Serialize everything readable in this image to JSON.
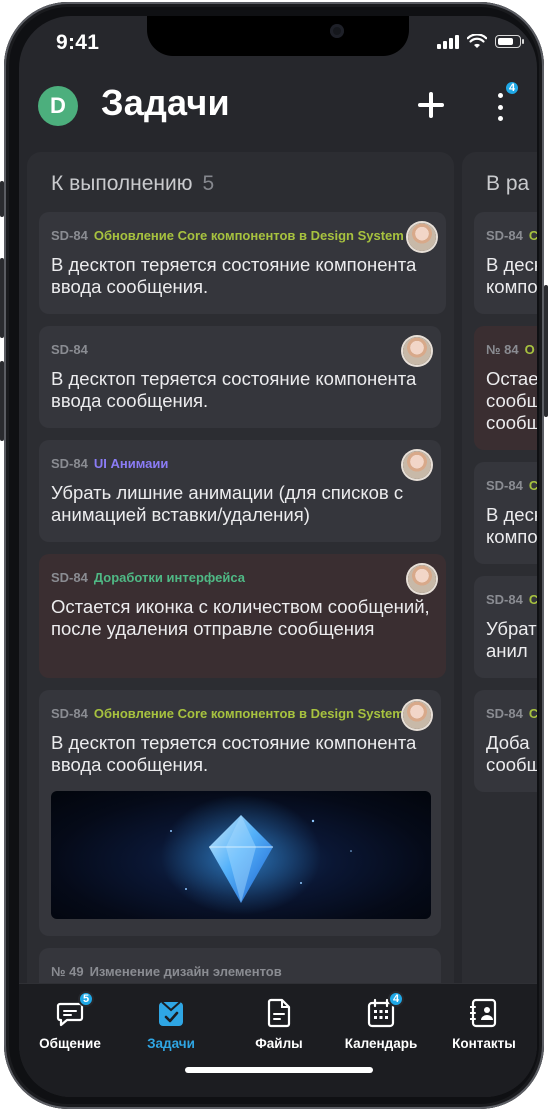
{
  "status_bar": {
    "time": "9:41",
    "battery_fraction": 0.85
  },
  "header": {
    "avatar_letter": "D",
    "title": "Задачи",
    "more_badge": "4"
  },
  "columns": [
    {
      "title": "К выполнению",
      "count": "5",
      "cards": [
        {
          "id": "SD-84",
          "tag": "Обновление Core компонентов в Design System",
          "tag_color": "#a7c23f",
          "text": "В десктоп теряется состояние компонента ввода сообщения."
        },
        {
          "id": "SD-84",
          "tag": "",
          "tag_color": "",
          "text": "В десктоп теряется состояние компонента ввода сообщения."
        },
        {
          "id": "SD-84",
          "tag": "UI Анимаии",
          "tag_color": "#8b7cf6",
          "text": "Убрать лишние анимации (для списков с анимацией вставки/удаления)"
        },
        {
          "id": "SD-84",
          "tag": "Доработки интерфейса",
          "tag_color": "#4fb985",
          "text": "Остается иконка с количеством сообщений, после удаления отправле сообщения"
        },
        {
          "id": "SD-84",
          "tag": "Обновление Core компонентов в Design System",
          "tag_color": "#a7c23f",
          "text": "В десктоп теряется состояние компонента ввода сообщения."
        },
        {
          "id": "№ 49",
          "tag": "Изменение дизайн элементов",
          "tag_color": "#8a8c92",
          "text": ""
        }
      ]
    },
    {
      "title": "В ра",
      "count": "",
      "cards": [
        {
          "id": "SD-84",
          "tag": "",
          "tag_color": "#a7c23f",
          "text": "В деск компон"
        },
        {
          "id": "№ 84",
          "tag": "О",
          "tag_color": "#a7c23f",
          "text": "Остае сообщ сообщ"
        },
        {
          "id": "SD-84",
          "tag": "",
          "tag_color": "#a7c23f",
          "text": "В деск компон"
        },
        {
          "id": "SD-84",
          "tag": "",
          "tag_color": "#a7c23f",
          "text": "Убрат с анил"
        },
        {
          "id": "SD-84",
          "tag": "",
          "tag_color": "#a7c23f",
          "text": "Доба сообщ"
        }
      ]
    }
  ],
  "tabbar": {
    "active": "tasks",
    "tabs": [
      {
        "key": "chat",
        "label": "Общение",
        "badge": "5",
        "icon": "chat-icon"
      },
      {
        "key": "tasks",
        "label": "Задачи",
        "badge": "",
        "icon": "tasks-icon"
      },
      {
        "key": "files",
        "label": "Файлы",
        "badge": "",
        "icon": "file-icon"
      },
      {
        "key": "calendar",
        "label": "Календарь",
        "badge": "4",
        "icon": "calendar-icon"
      },
      {
        "key": "contacts",
        "label": "Контакты",
        "badge": "",
        "icon": "contacts-icon"
      }
    ]
  },
  "colors": {
    "accent": "#2fa6e4",
    "badge": "#1fa8e6",
    "avatar_d": "#4caf7d"
  }
}
